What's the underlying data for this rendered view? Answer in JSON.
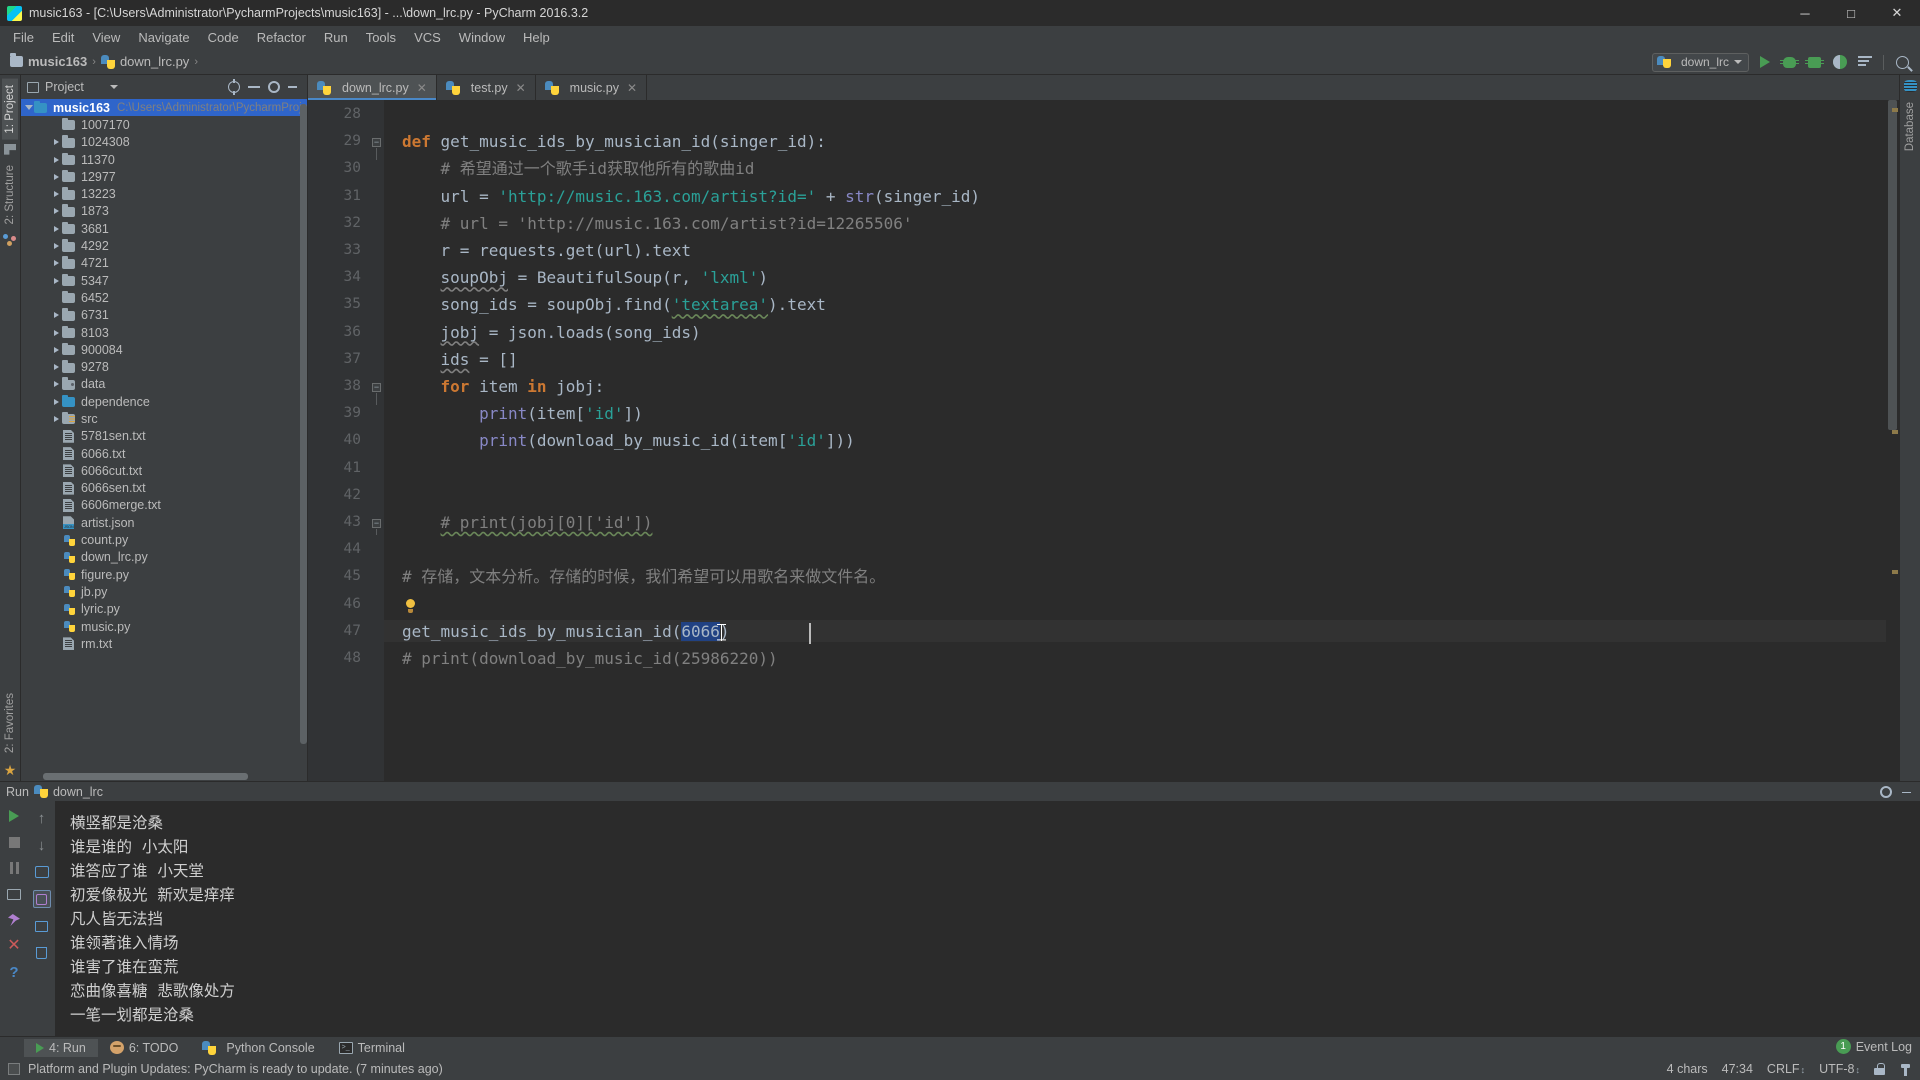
{
  "window": {
    "title": "music163 - [C:\\Users\\Administrator\\PycharmProjects\\music163] - ...\\down_lrc.py - PyCharm 2016.3.2",
    "minimize": "─",
    "maximize": "□",
    "close": "✕",
    "logo_text": "PC"
  },
  "menu": {
    "items": [
      {
        "label": "File",
        "mnemonic": "F"
      },
      {
        "label": "Edit",
        "mnemonic": "E"
      },
      {
        "label": "View",
        "mnemonic": "V"
      },
      {
        "label": "Navigate",
        "mnemonic": "N"
      },
      {
        "label": "Code",
        "mnemonic": "C"
      },
      {
        "label": "Refactor",
        "mnemonic": "R"
      },
      {
        "label": "Run",
        "mnemonic": "u"
      },
      {
        "label": "Tools",
        "mnemonic": "T"
      },
      {
        "label": "VCS",
        "mnemonic": "V"
      },
      {
        "label": "Window",
        "mnemonic": "W"
      },
      {
        "label": "Help",
        "mnemonic": "H"
      }
    ]
  },
  "navbar": {
    "project": "music163",
    "file": "down_lrc.py",
    "separator": "›"
  },
  "toolbar": {
    "run_config": "down_lrc",
    "icons": [
      "run-icon",
      "debug-icon",
      "coverage-icon",
      "profile-icon",
      "stack-icon",
      "search-everywhere-icon"
    ]
  },
  "left_tool_tabs": [
    {
      "label": "1: Project",
      "mnemonic": "1",
      "active": true
    },
    {
      "label": "2: Structure",
      "mnemonic": "2",
      "active": false
    }
  ],
  "left_bottom_tabs": [
    {
      "label": "2: Favorites",
      "mnemonic": "2"
    }
  ],
  "right_tool_tabs": [
    {
      "label": "Database"
    }
  ],
  "project_panel": {
    "title": "Project",
    "root": {
      "label": "music163",
      "path": "C:\\Users\\Administrator\\PycharmProject",
      "expanded": true,
      "selected": true
    },
    "items": [
      {
        "label": "1007170",
        "type": "folder",
        "arrow": false,
        "indent": 2
      },
      {
        "label": "1024308",
        "type": "folder",
        "arrow": true,
        "indent": 2
      },
      {
        "label": "11370",
        "type": "folder",
        "arrow": true,
        "indent": 2
      },
      {
        "label": "12977",
        "type": "folder",
        "arrow": true,
        "indent": 2
      },
      {
        "label": "13223",
        "type": "folder",
        "arrow": true,
        "indent": 2
      },
      {
        "label": "1873",
        "type": "folder",
        "arrow": true,
        "indent": 2
      },
      {
        "label": "3681",
        "type": "folder",
        "arrow": true,
        "indent": 2
      },
      {
        "label": "4292",
        "type": "folder",
        "arrow": true,
        "indent": 2
      },
      {
        "label": "4721",
        "type": "folder",
        "arrow": true,
        "indent": 2
      },
      {
        "label": "5347",
        "type": "folder",
        "arrow": true,
        "indent": 2
      },
      {
        "label": "6452",
        "type": "folder",
        "arrow": false,
        "indent": 2
      },
      {
        "label": "6731",
        "type": "folder",
        "arrow": true,
        "indent": 2
      },
      {
        "label": "8103",
        "type": "folder",
        "arrow": true,
        "indent": 2
      },
      {
        "label": "900084",
        "type": "folder",
        "arrow": true,
        "indent": 2
      },
      {
        "label": "9278",
        "type": "folder",
        "arrow": true,
        "indent": 2
      },
      {
        "label": "data",
        "type": "folder-dot",
        "arrow": true,
        "indent": 2
      },
      {
        "label": "dependence",
        "type": "folder-blue",
        "arrow": true,
        "indent": 2
      },
      {
        "label": "src",
        "type": "folder-src",
        "arrow": true,
        "indent": 2
      },
      {
        "label": "5781sen.txt",
        "type": "txt",
        "arrow": false,
        "indent": 2
      },
      {
        "label": "6066.txt",
        "type": "txt",
        "arrow": false,
        "indent": 2
      },
      {
        "label": "6066cut.txt",
        "type": "txt",
        "arrow": false,
        "indent": 2
      },
      {
        "label": "6066sen.txt",
        "type": "txt",
        "arrow": false,
        "indent": 2
      },
      {
        "label": "6606merge.txt",
        "type": "txt",
        "arrow": false,
        "indent": 2
      },
      {
        "label": "artist.json",
        "type": "json",
        "arrow": false,
        "indent": 2
      },
      {
        "label": "count.py",
        "type": "py",
        "arrow": false,
        "indent": 2
      },
      {
        "label": "down_lrc.py",
        "type": "py",
        "arrow": false,
        "indent": 2
      },
      {
        "label": "figure.py",
        "type": "py",
        "arrow": false,
        "indent": 2
      },
      {
        "label": "jb.py",
        "type": "py",
        "arrow": false,
        "indent": 2
      },
      {
        "label": "lyric.py",
        "type": "py",
        "arrow": false,
        "indent": 2
      },
      {
        "label": "music.py",
        "type": "py",
        "arrow": false,
        "indent": 2
      },
      {
        "label": "rm.txt",
        "type": "txt",
        "arrow": false,
        "indent": 2
      }
    ]
  },
  "editor": {
    "tabs": [
      {
        "label": "down_lrc.py",
        "active": true,
        "close": "✕"
      },
      {
        "label": "test.py",
        "active": false,
        "close": "✕"
      },
      {
        "label": "music.py",
        "active": false,
        "close": "✕"
      }
    ],
    "first_line": 28,
    "lines": [
      {
        "n": 28,
        "text": ""
      },
      {
        "n": 29,
        "text": "def get_music_ids_by_musician_id(singer_id):"
      },
      {
        "n": 30,
        "text": "    # 希望通过一个歌手id获取他所有的歌曲id"
      },
      {
        "n": 31,
        "text": "    url = 'http://music.163.com/artist?id=' + str(singer_id)"
      },
      {
        "n": 32,
        "text": "    # url = 'http://music.163.com/artist?id=12265506'"
      },
      {
        "n": 33,
        "text": "    r = requests.get(url).text"
      },
      {
        "n": 34,
        "text": "    soupObj = BeautifulSoup(r, 'lxml')"
      },
      {
        "n": 35,
        "text": "    song_ids = soupObj.find('textarea').text"
      },
      {
        "n": 36,
        "text": "    jobj = json.loads(song_ids)"
      },
      {
        "n": 37,
        "text": "    ids = []"
      },
      {
        "n": 38,
        "text": "    for item in jobj:"
      },
      {
        "n": 39,
        "text": "        print(item['id'])"
      },
      {
        "n": 40,
        "text": "        print(download_by_music_id(item['id']))"
      },
      {
        "n": 41,
        "text": ""
      },
      {
        "n": 42,
        "text": ""
      },
      {
        "n": 43,
        "text": "    # print(jobj[0]['id'])"
      },
      {
        "n": 44,
        "text": ""
      },
      {
        "n": 45,
        "text": "# 存储，文本分析。存储的时候，我们希望可以用歌名来做文件名。"
      },
      {
        "n": 46,
        "text": ""
      },
      {
        "n": 47,
        "text": "get_music_ids_by_musician_id(6066)"
      },
      {
        "n": 48,
        "text": "# print(download_by_music_id(25986220))"
      }
    ],
    "selection": "6066",
    "intention_bulb": "lightbulb-icon"
  },
  "run_panel": {
    "title": "Run",
    "config_name": "down_lrc",
    "console_lines": [
      "一笔一划都是沧桑",
      "横竖都是沧桑",
      "",
      "谁是谁的  小太阳",
      "谁答应了谁  小天堂",
      "初爱像极光  新欢是痒痒",
      "凡人皆无法挡",
      "谁领著谁入情场",
      "谁害了谁在蛮荒",
      "恋曲像喜糖  悲歌像处方",
      "一笔一划都是沧桑"
    ],
    "left_tools": [
      "rerun-icon",
      "stop-icon",
      "pause-icon",
      "print-icon",
      "pin-icon",
      "close-icon",
      "help-icon"
    ],
    "second_tools": [
      "up-icon",
      "down-icon",
      "soft-wrap-icon",
      "scroll-to-end-icon",
      "print-icon",
      "trash-icon"
    ],
    "header_tools": [
      "settings-icon",
      "hide-icon"
    ]
  },
  "bottom_tabs": [
    {
      "label": "4: Run",
      "mnemonic": "4",
      "icon": "run-icon",
      "active": true
    },
    {
      "label": "6: TODO",
      "mnemonic": "6",
      "icon": "todo-icon",
      "active": false
    },
    {
      "label": "Python Console",
      "mnemonic": "",
      "icon": "python-icon",
      "active": false
    },
    {
      "label": "Terminal",
      "mnemonic": "",
      "icon": "terminal-icon",
      "active": false
    }
  ],
  "status_bar": {
    "message": "Platform and Plugin Updates: PyCharm is ready to update. (7 minutes ago)",
    "chars": "4 chars",
    "caret_position": "47:34",
    "line_separator": "CRLF",
    "encoding": "UTF-8",
    "event_log": "Event Log",
    "event_log_count": "1"
  }
}
